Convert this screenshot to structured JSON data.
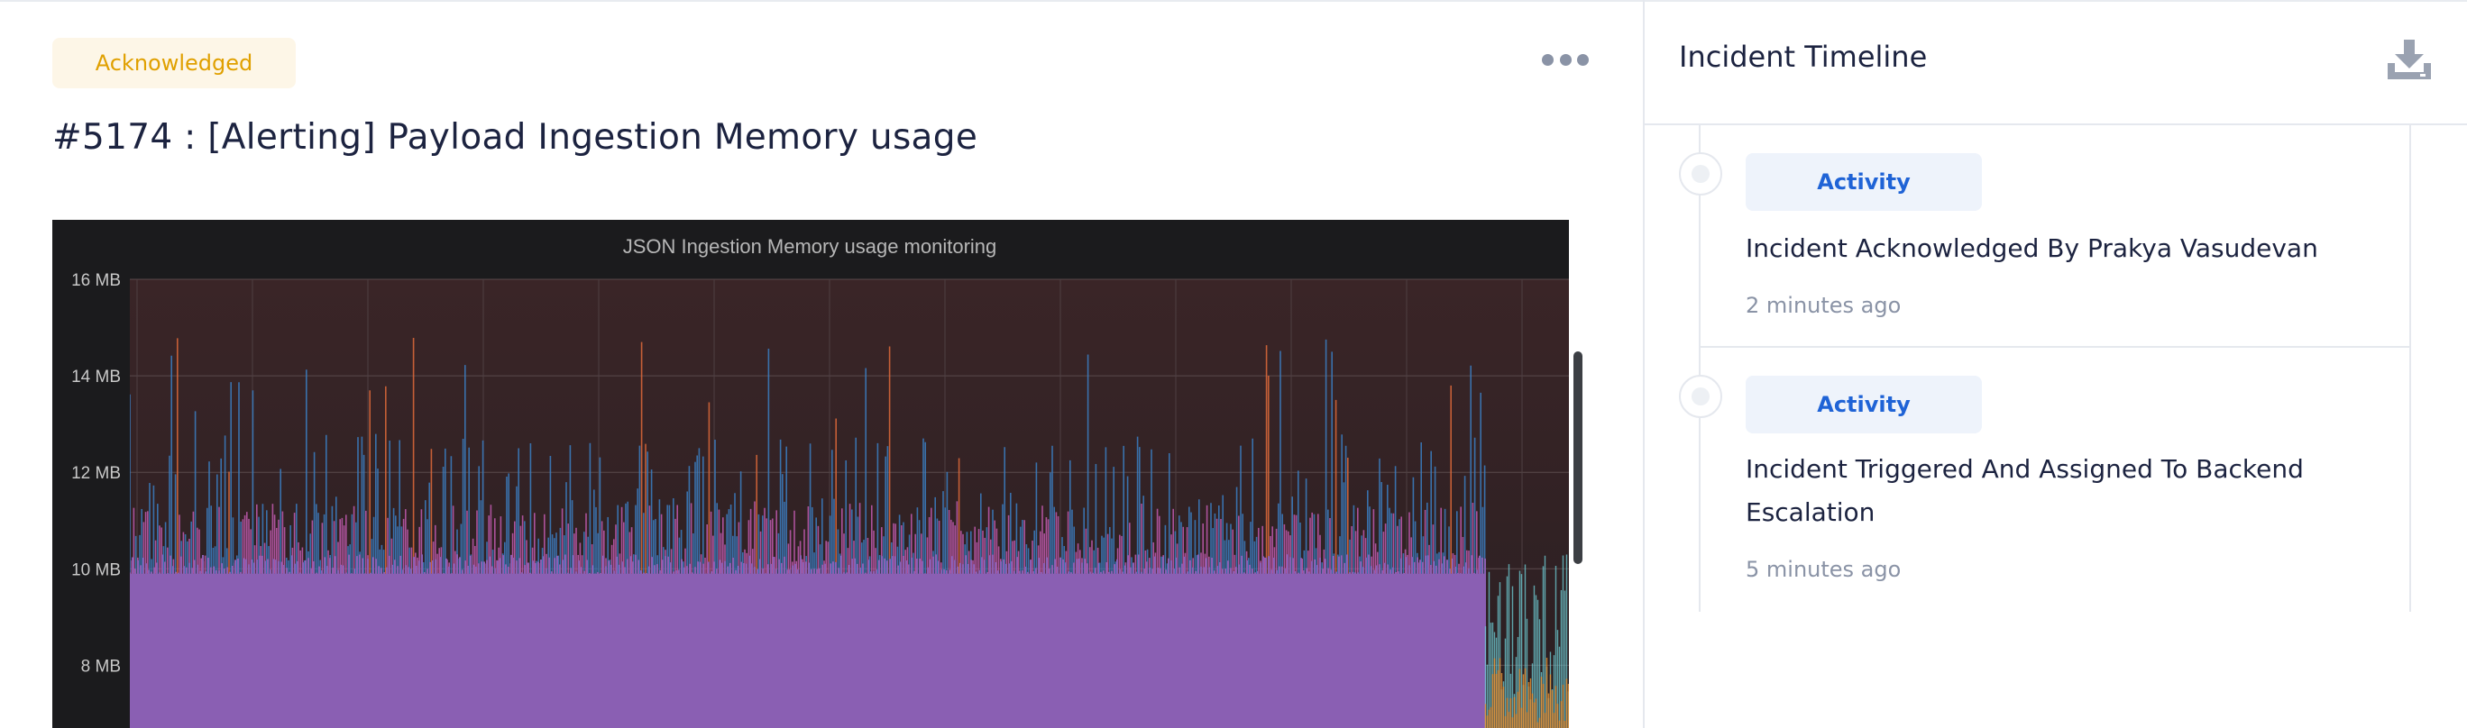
{
  "incident": {
    "status_label": "Acknowledged",
    "title": "#5174 : [Alerting] Payload Ingestion Memory usage",
    "more_icon": "more-horizontal-icon"
  },
  "chart_data": {
    "type": "area",
    "title": "JSON Ingestion Memory usage monitoring",
    "ylabel": "",
    "y_ticks": [
      "16 MB",
      "14 MB",
      "12 MB",
      "10 MB",
      "8 MB"
    ],
    "ylim_mb": [
      6.7,
      16
    ],
    "series_colors": [
      "#8a5fb3",
      "#3b7fc4",
      "#e06a3a",
      "#c25bb0",
      "#6fd0d8",
      "#e8902f"
    ],
    "baseline_mb": 9.9,
    "noise_band_mb": [
      10.1,
      11.4
    ],
    "max_spike_mb": 14.8,
    "drop_region_fraction": 0.935,
    "grid": true,
    "threshold_line": "dotted orange at right edge"
  },
  "timeline": {
    "title": "Incident Timeline",
    "download_icon": "download-icon",
    "items": [
      {
        "chip": "Activity",
        "text": "Incident Acknowledged By Prakya Vasudevan",
        "time": "2 minutes ago"
      },
      {
        "chip": "Activity",
        "text": "Incident Triggered And Assigned To Backend Escalation",
        "time": "5 minutes ago"
      }
    ]
  }
}
